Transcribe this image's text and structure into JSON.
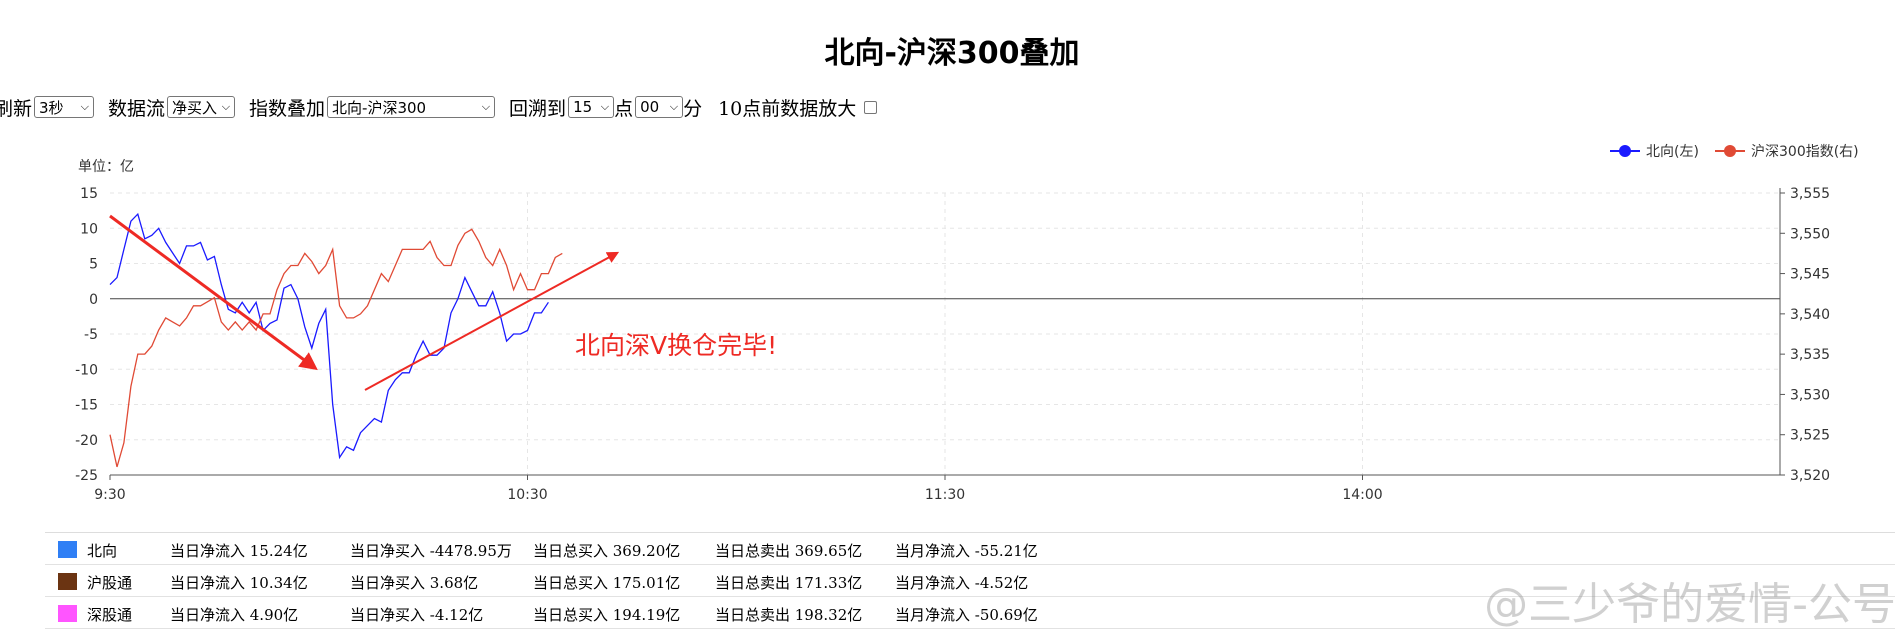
{
  "title": "北向-沪深300叠加",
  "controls": {
    "refresh_label": "刷新",
    "refresh_value": "3秒",
    "dataflow_label": "数据流",
    "dataflow_value": "净买入",
    "overlay_label": "指数叠加",
    "overlay_value": "北向-沪深300",
    "rewind_label": "回溯到",
    "hour_value": "15",
    "hour_unit": "点",
    "minute_value": "00",
    "minute_unit": "分",
    "zoom_label": "10点前数据放大"
  },
  "chart_data": {
    "type": "line",
    "unit_label": "单位：亿",
    "x_ticks": [
      "9:30",
      "10:30",
      "11:30",
      "14:00"
    ],
    "y_left": {
      "ticks": [
        "15",
        "10",
        "5",
        "0",
        "-5",
        "-10",
        "-15",
        "-20",
        "-25"
      ],
      "range": [
        -25,
        15
      ]
    },
    "y_right": {
      "ticks": [
        "3,555",
        "3,550",
        "3,545",
        "3,540",
        "3,535",
        "3,530",
        "3,525",
        "3,520"
      ],
      "range": [
        3520,
        3555
      ]
    },
    "grid": true,
    "legend_position": "top-right",
    "series": [
      {
        "name": "北向(左)",
        "axis": "left",
        "color": "#1a1aff",
        "values": [
          2,
          3,
          7,
          11,
          12,
          8.5,
          9,
          10,
          8,
          6.5,
          5,
          7.5,
          7.5,
          8,
          5.5,
          6,
          2,
          -1.5,
          -2,
          -0.5,
          -2,
          -0.5,
          -4.5,
          -3.5,
          -3,
          1.5,
          2,
          0,
          -4,
          -7,
          -3.5,
          -1.5,
          -15,
          -22.5,
          -21,
          -21.5,
          -19,
          -18,
          -17,
          -17.5,
          -13,
          -11.5,
          -10.5,
          -10.5,
          -8,
          -6,
          -8,
          -8,
          -7,
          -2,
          0,
          3,
          1,
          -1,
          -1,
          1,
          -2,
          -6,
          -5,
          -5,
          -4.5,
          -2,
          -2,
          -0.5
        ]
      },
      {
        "name": "沪深300指数(右)",
        "axis": "right",
        "color": "#e04a35",
        "values": [
          3525,
          3521,
          3524,
          3531,
          3535,
          3535,
          3536,
          3538,
          3539.5,
          3539,
          3538.5,
          3539.5,
          3541,
          3541,
          3541.5,
          3542,
          3539,
          3538,
          3539,
          3538,
          3539,
          3538,
          3540,
          3540,
          3543,
          3545,
          3546,
          3546,
          3547.5,
          3546.5,
          3545,
          3546,
          3548,
          3541,
          3539.5,
          3539.5,
          3540,
          3541,
          3543,
          3545,
          3544,
          3546,
          3548,
          3548,
          3548,
          3548,
          3549,
          3547,
          3546,
          3546,
          3548.5,
          3550,
          3550.5,
          3549,
          3547,
          3546,
          3548,
          3546,
          3543,
          3545,
          3543,
          3543,
          3545,
          3545,
          3547,
          3547.5
        ]
      }
    ],
    "annotation": "北向深V换仓完毕!"
  },
  "table": {
    "rows": [
      {
        "name": "北向",
        "color": "#2f7ff5",
        "net_inflow": "当日净流入 15.24亿",
        "net_buy": "当日净买入 -4478.95万",
        "total_buy": "当日总买入 369.20亿",
        "total_sell": "当日总卖出 369.65亿",
        "month_inflow": "当月净流入 -55.21亿"
      },
      {
        "name": "沪股通",
        "color": "#6b3412",
        "net_inflow": "当日净流入 10.34亿",
        "net_buy": "当日净买入 3.68亿",
        "total_buy": "当日总买入 175.01亿",
        "total_sell": "当日总卖出 171.33亿",
        "month_inflow": "当月净流入 -4.52亿"
      },
      {
        "name": "深股通",
        "color": "#ff55ff",
        "net_inflow": "当日净流入 4.90亿",
        "net_buy": "当日净买入 -4.12亿",
        "total_buy": "当日总买入 194.19亿",
        "total_sell": "当日总卖出 198.32亿",
        "month_inflow": "当月净流入 -50.69亿"
      }
    ]
  },
  "watermark": "@三少爷的爱情-公号"
}
